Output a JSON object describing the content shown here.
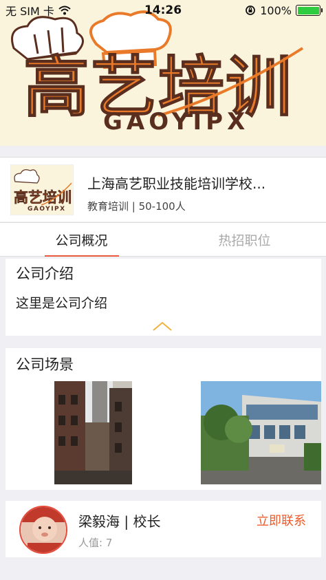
{
  "status_bar": {
    "carrier": "无 SIM 卡",
    "time": "14:26",
    "battery_percent": "100%",
    "wifi_icon": "wifi-icon",
    "rotation_lock_icon": "rotation-lock-icon",
    "battery_level": 1.0,
    "battery_color": "#2ecc40"
  },
  "banner": {
    "logo_chinese": "高艺培训",
    "logo_pinyin": "GAOYIPX",
    "brand_orange": "#e87a2a",
    "brand_dark": "#5a2e1e"
  },
  "company": {
    "name": "上海高艺职业技能培训学校...",
    "meta": "教育培训 | 50-100人"
  },
  "tabs": [
    {
      "label": "公司概况",
      "active": true
    },
    {
      "label": "热招职位",
      "active": false
    }
  ],
  "intro": {
    "title": "公司介绍",
    "text": "这里是公司介绍",
    "collapse_icon": "chevron-up-icon"
  },
  "scenes": {
    "title": "公司场景"
  },
  "contact": {
    "name": "梁毅海 | 校长",
    "popularity": "人值: 7",
    "action_label": "立即联系",
    "action_color": "#f05a28"
  }
}
